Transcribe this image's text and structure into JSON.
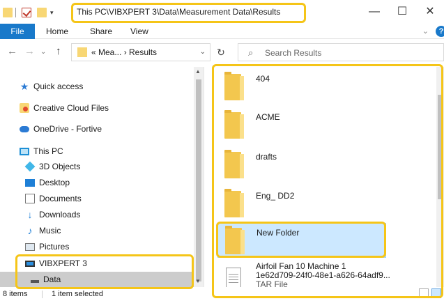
{
  "window": {
    "title": "This PC\\VIBXPERT 3\\Data\\Measurement Data\\Results",
    "minimize": "—",
    "maximize": "☐",
    "close": "✕"
  },
  "ribbon": {
    "file": "File",
    "tabs": [
      "Home",
      "Share",
      "View"
    ],
    "expand": "⌄",
    "help": "?"
  },
  "nav": {
    "back": "←",
    "forward": "→",
    "recent": "⌄",
    "up": "↑",
    "address_crumb": "« Mea... › Results",
    "address_dropdown": "⌄",
    "refresh": "↻",
    "search_placeholder": "Search Results"
  },
  "sidebar": {
    "items": [
      {
        "label": "Quick access",
        "icon": "star-icon"
      },
      {
        "label": "Creative Cloud Files",
        "icon": "creative-cloud-icon"
      },
      {
        "label": "OneDrive - Fortive",
        "icon": "cloud-icon"
      },
      {
        "label": "This PC",
        "icon": "computer-icon"
      },
      {
        "label": "3D Objects",
        "icon": "cube-icon"
      },
      {
        "label": "Desktop",
        "icon": "desktop-icon"
      },
      {
        "label": "Documents",
        "icon": "documents-icon"
      },
      {
        "label": "Downloads",
        "icon": "download-icon"
      },
      {
        "label": "Music",
        "icon": "music-icon"
      },
      {
        "label": "Pictures",
        "icon": "pictures-icon"
      },
      {
        "label": "VIBXPERT 3",
        "icon": "drive-icon"
      },
      {
        "label": "Data",
        "icon": "folder-icon"
      }
    ]
  },
  "files": [
    {
      "name": "404",
      "type": "folder"
    },
    {
      "name": "ACME",
      "type": "folder"
    },
    {
      "name": "drafts",
      "type": "folder"
    },
    {
      "name": "Eng_ DD2",
      "type": "folder"
    },
    {
      "name": "New Folder",
      "type": "folder",
      "selected": true
    },
    {
      "name": "Airfoil Fan 10 Machine 1",
      "name2": "1e62d709-24f0-48e1-a626-64adf9...",
      "kind": "TAR File",
      "type": "file"
    }
  ],
  "status": {
    "items": "8 items",
    "selected": "1 item selected"
  },
  "colors": {
    "accent": "#1979ca",
    "highlight": "#f5c518",
    "selection": "#cce8ff"
  }
}
